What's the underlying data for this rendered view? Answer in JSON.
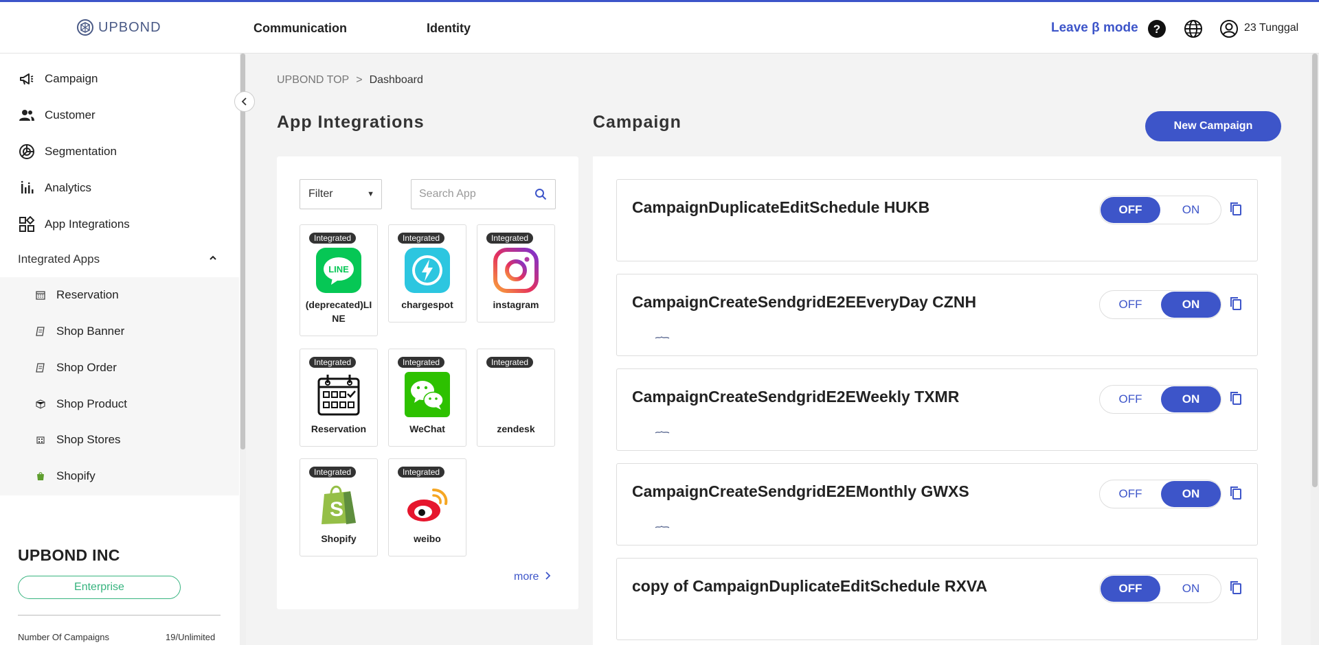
{
  "header": {
    "logo_text": "UPBOND",
    "nav": [
      "Communication",
      "Identity"
    ],
    "beta_link": "Leave β mode",
    "help_icon": "question-circle-icon",
    "language_icon": "globe-icon",
    "user_icon": "user-circle-icon",
    "user_name": "23 Tunggal",
    "accent_color": "#3d55c9"
  },
  "sidebar": {
    "items": [
      {
        "label": "Campaign",
        "icon": "megaphone-icon"
      },
      {
        "label": "Customer",
        "icon": "users-icon"
      },
      {
        "label": "Segmentation",
        "icon": "pie-chart-icon"
      },
      {
        "label": "Analytics",
        "icon": "bar-chart-icon"
      },
      {
        "label": "App Integrations",
        "icon": "apps-grid-icon"
      }
    ],
    "group_label": "Integrated Apps",
    "sub_items": [
      {
        "label": "Reservation",
        "icon": "calendar-icon"
      },
      {
        "label": "Shop Banner",
        "icon": "receipt-icon"
      },
      {
        "label": "Shop Order",
        "icon": "receipt-icon"
      },
      {
        "label": "Shop Product",
        "icon": "box-icon"
      },
      {
        "label": "Shop Stores",
        "icon": "store-icon"
      },
      {
        "label": "Shopify",
        "icon": "shopify-bag-icon"
      }
    ],
    "company_name": "UPBOND INC",
    "plan": "Enterprise",
    "stat_label": "Number Of Campaigns",
    "stat_value": "19/Unlimited"
  },
  "breadcrumb": {
    "root": "UPBOND TOP",
    "separator": ">",
    "current": "Dashboard"
  },
  "app_integrations": {
    "title": "App Integrations",
    "filter_label": "Filter",
    "search_placeholder": "Search App",
    "badge": "Integrated",
    "apps": [
      {
        "name": "(deprecated)LINE",
        "icon": "line-icon"
      },
      {
        "name": "chargespot",
        "icon": "chargespot-icon"
      },
      {
        "name": "instagram",
        "icon": "instagram-icon"
      },
      {
        "name": "Reservation",
        "icon": "calendar-icon"
      },
      {
        "name": "WeChat",
        "icon": "wechat-icon"
      },
      {
        "name": "zendesk",
        "icon": "zendesk-icon"
      },
      {
        "name": "Shopify",
        "icon": "shopify-icon"
      },
      {
        "name": "weibo",
        "icon": "weibo-icon"
      }
    ],
    "more_label": "more"
  },
  "campaign": {
    "title": "Campaign",
    "new_button": "New Campaign",
    "off_label": "OFF",
    "on_label": "ON",
    "items": [
      {
        "name": "CampaignDuplicateEditSchedule HUKB",
        "state": "OFF"
      },
      {
        "name": "CampaignCreateSendgridE2EEveryDay CZNH",
        "state": "ON"
      },
      {
        "name": "CampaignCreateSendgridE2EWeekly TXMR",
        "state": "ON"
      },
      {
        "name": "CampaignCreateSendgridE2EMonthly GWXS",
        "state": "ON"
      },
      {
        "name": "copy of CampaignDuplicateEditSchedule RXVA",
        "state": "OFF"
      }
    ]
  }
}
